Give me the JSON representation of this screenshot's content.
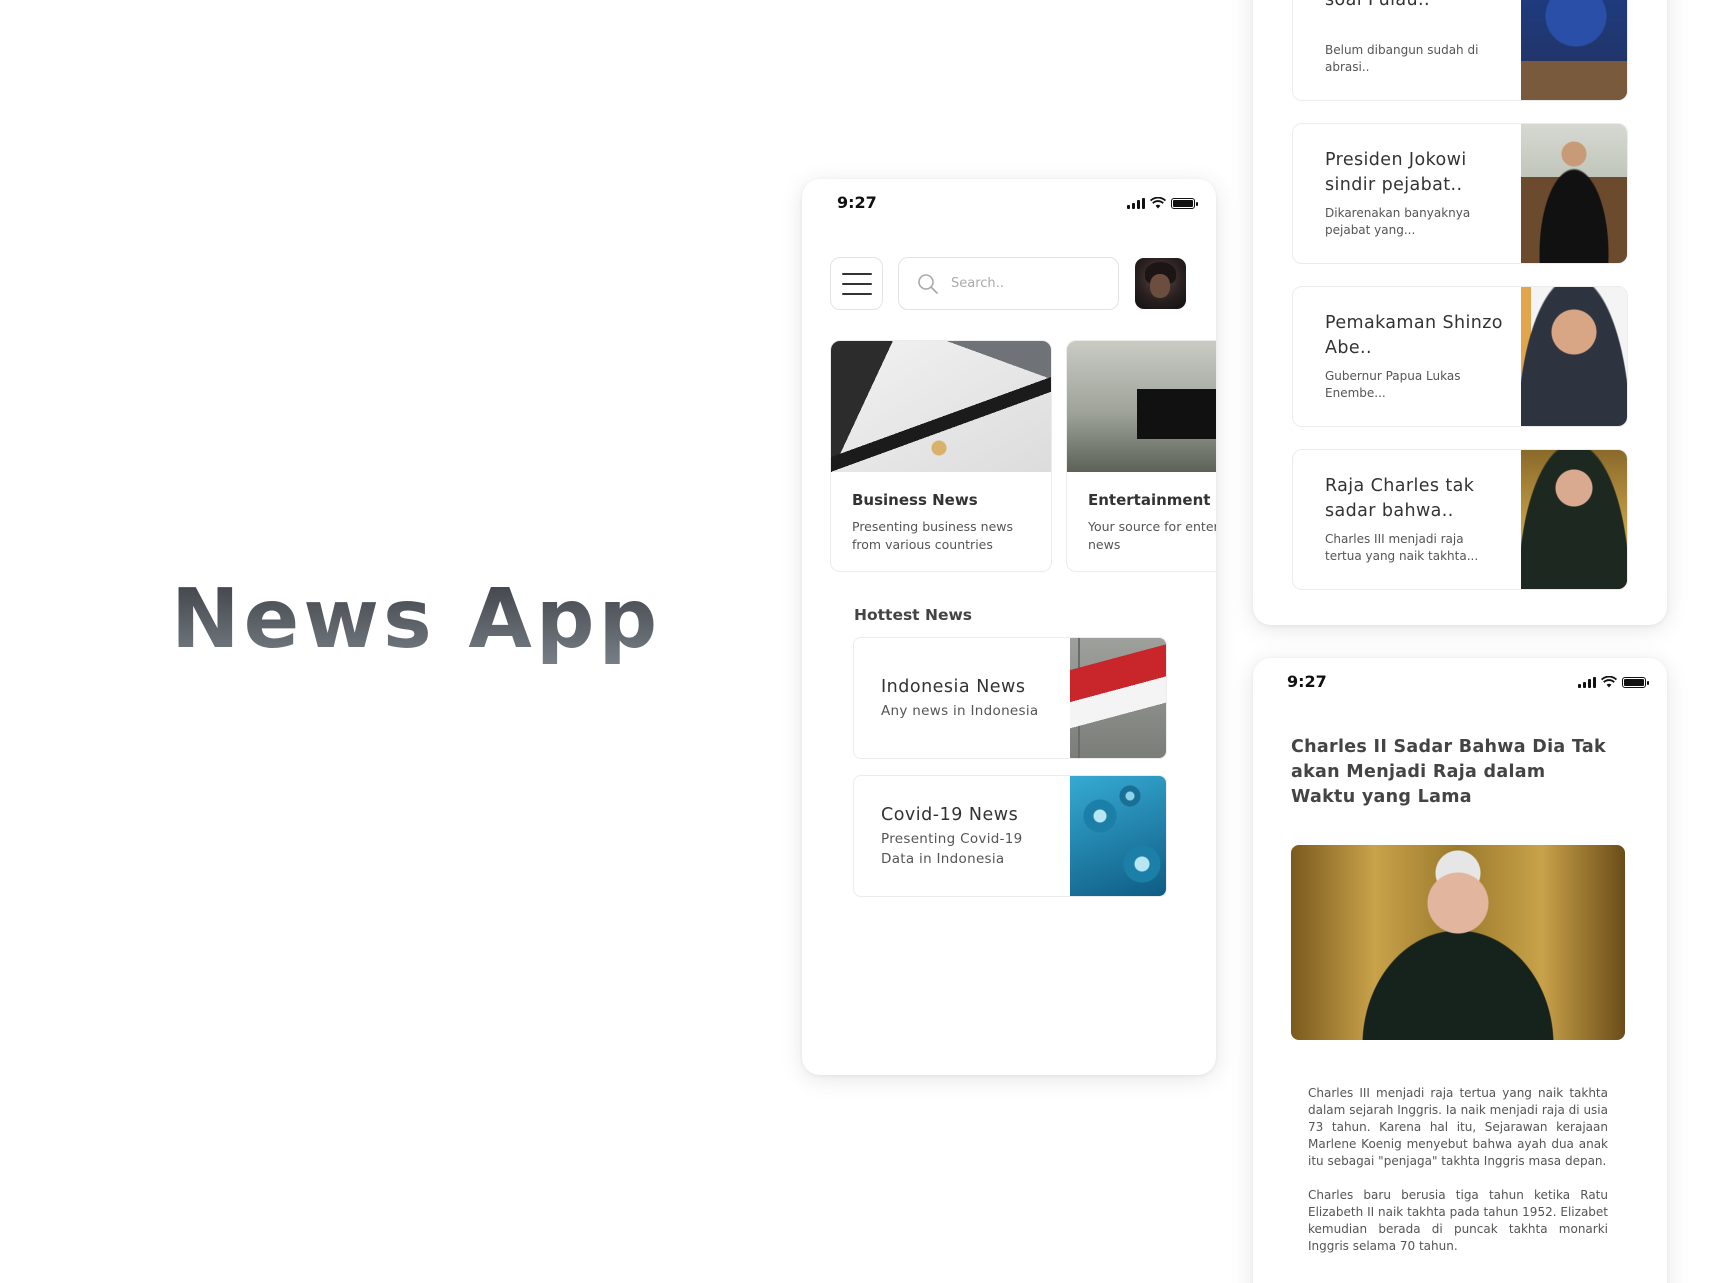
{
  "hero": {
    "title": "News App"
  },
  "home": {
    "status": {
      "time": "9:27"
    },
    "search": {
      "placeholder": "Search.."
    },
    "categories": [
      {
        "title": "Business News",
        "description": "Presenting business news from various countries"
      },
      {
        "title": "Entertainment N",
        "description": "Your source for entertainment news"
      }
    ],
    "hottest": {
      "title": "Hottest News",
      "items": [
        {
          "title": "Indonesia News",
          "description": "Any news in Indonesia"
        },
        {
          "title": "Covid-19 News",
          "description": "Presenting Covid-19 Data in Indonesia"
        }
      ]
    }
  },
  "list": {
    "items": [
      {
        "title": "Pimpinan DPRD DKI soal Pulau..",
        "description": "Belum dibangun sudah di abrasi.."
      },
      {
        "title": "Presiden Jokowi sindir pejabat..",
        "description": "Dikarenakan banyaknya pejabat yang..."
      },
      {
        "title": "Pemakaman Shinzo Abe..",
        "description": "Gubernur Papua Lukas Enembe..."
      },
      {
        "title": "Raja Charles tak sadar bahwa..",
        "description": "Charles III menjadi raja tertua yang naik takhta..."
      }
    ]
  },
  "article": {
    "status": {
      "time": "9:27"
    },
    "title": "Charles II Sadar Bahwa Dia Tak akan Menjadi Raja dalam Waktu yang Lama",
    "paragraphs": [
      "Charles III menjadi raja tertua yang naik takhta dalam sejarah Inggris. Ia naik menjadi raja di usia 73 tahun. Karena hal itu, Sejarawan kerajaan Marlene Koenig menyebut bahwa ayah dua anak itu sebagai \"penjaga\" takhta Inggris masa depan.",
      "Charles baru berusia tiga tahun ketika Ratu Elizabeth II naik takhta pada tahun 1952. Elizabet kemudian berada di puncak takhta monarki Inggris selama 70 tahun."
    ]
  },
  "icons": {
    "signal": "signal-icon",
    "wifi": "wifi-icon",
    "battery": "battery-icon",
    "menu": "menu-icon",
    "search": "search-icon"
  }
}
